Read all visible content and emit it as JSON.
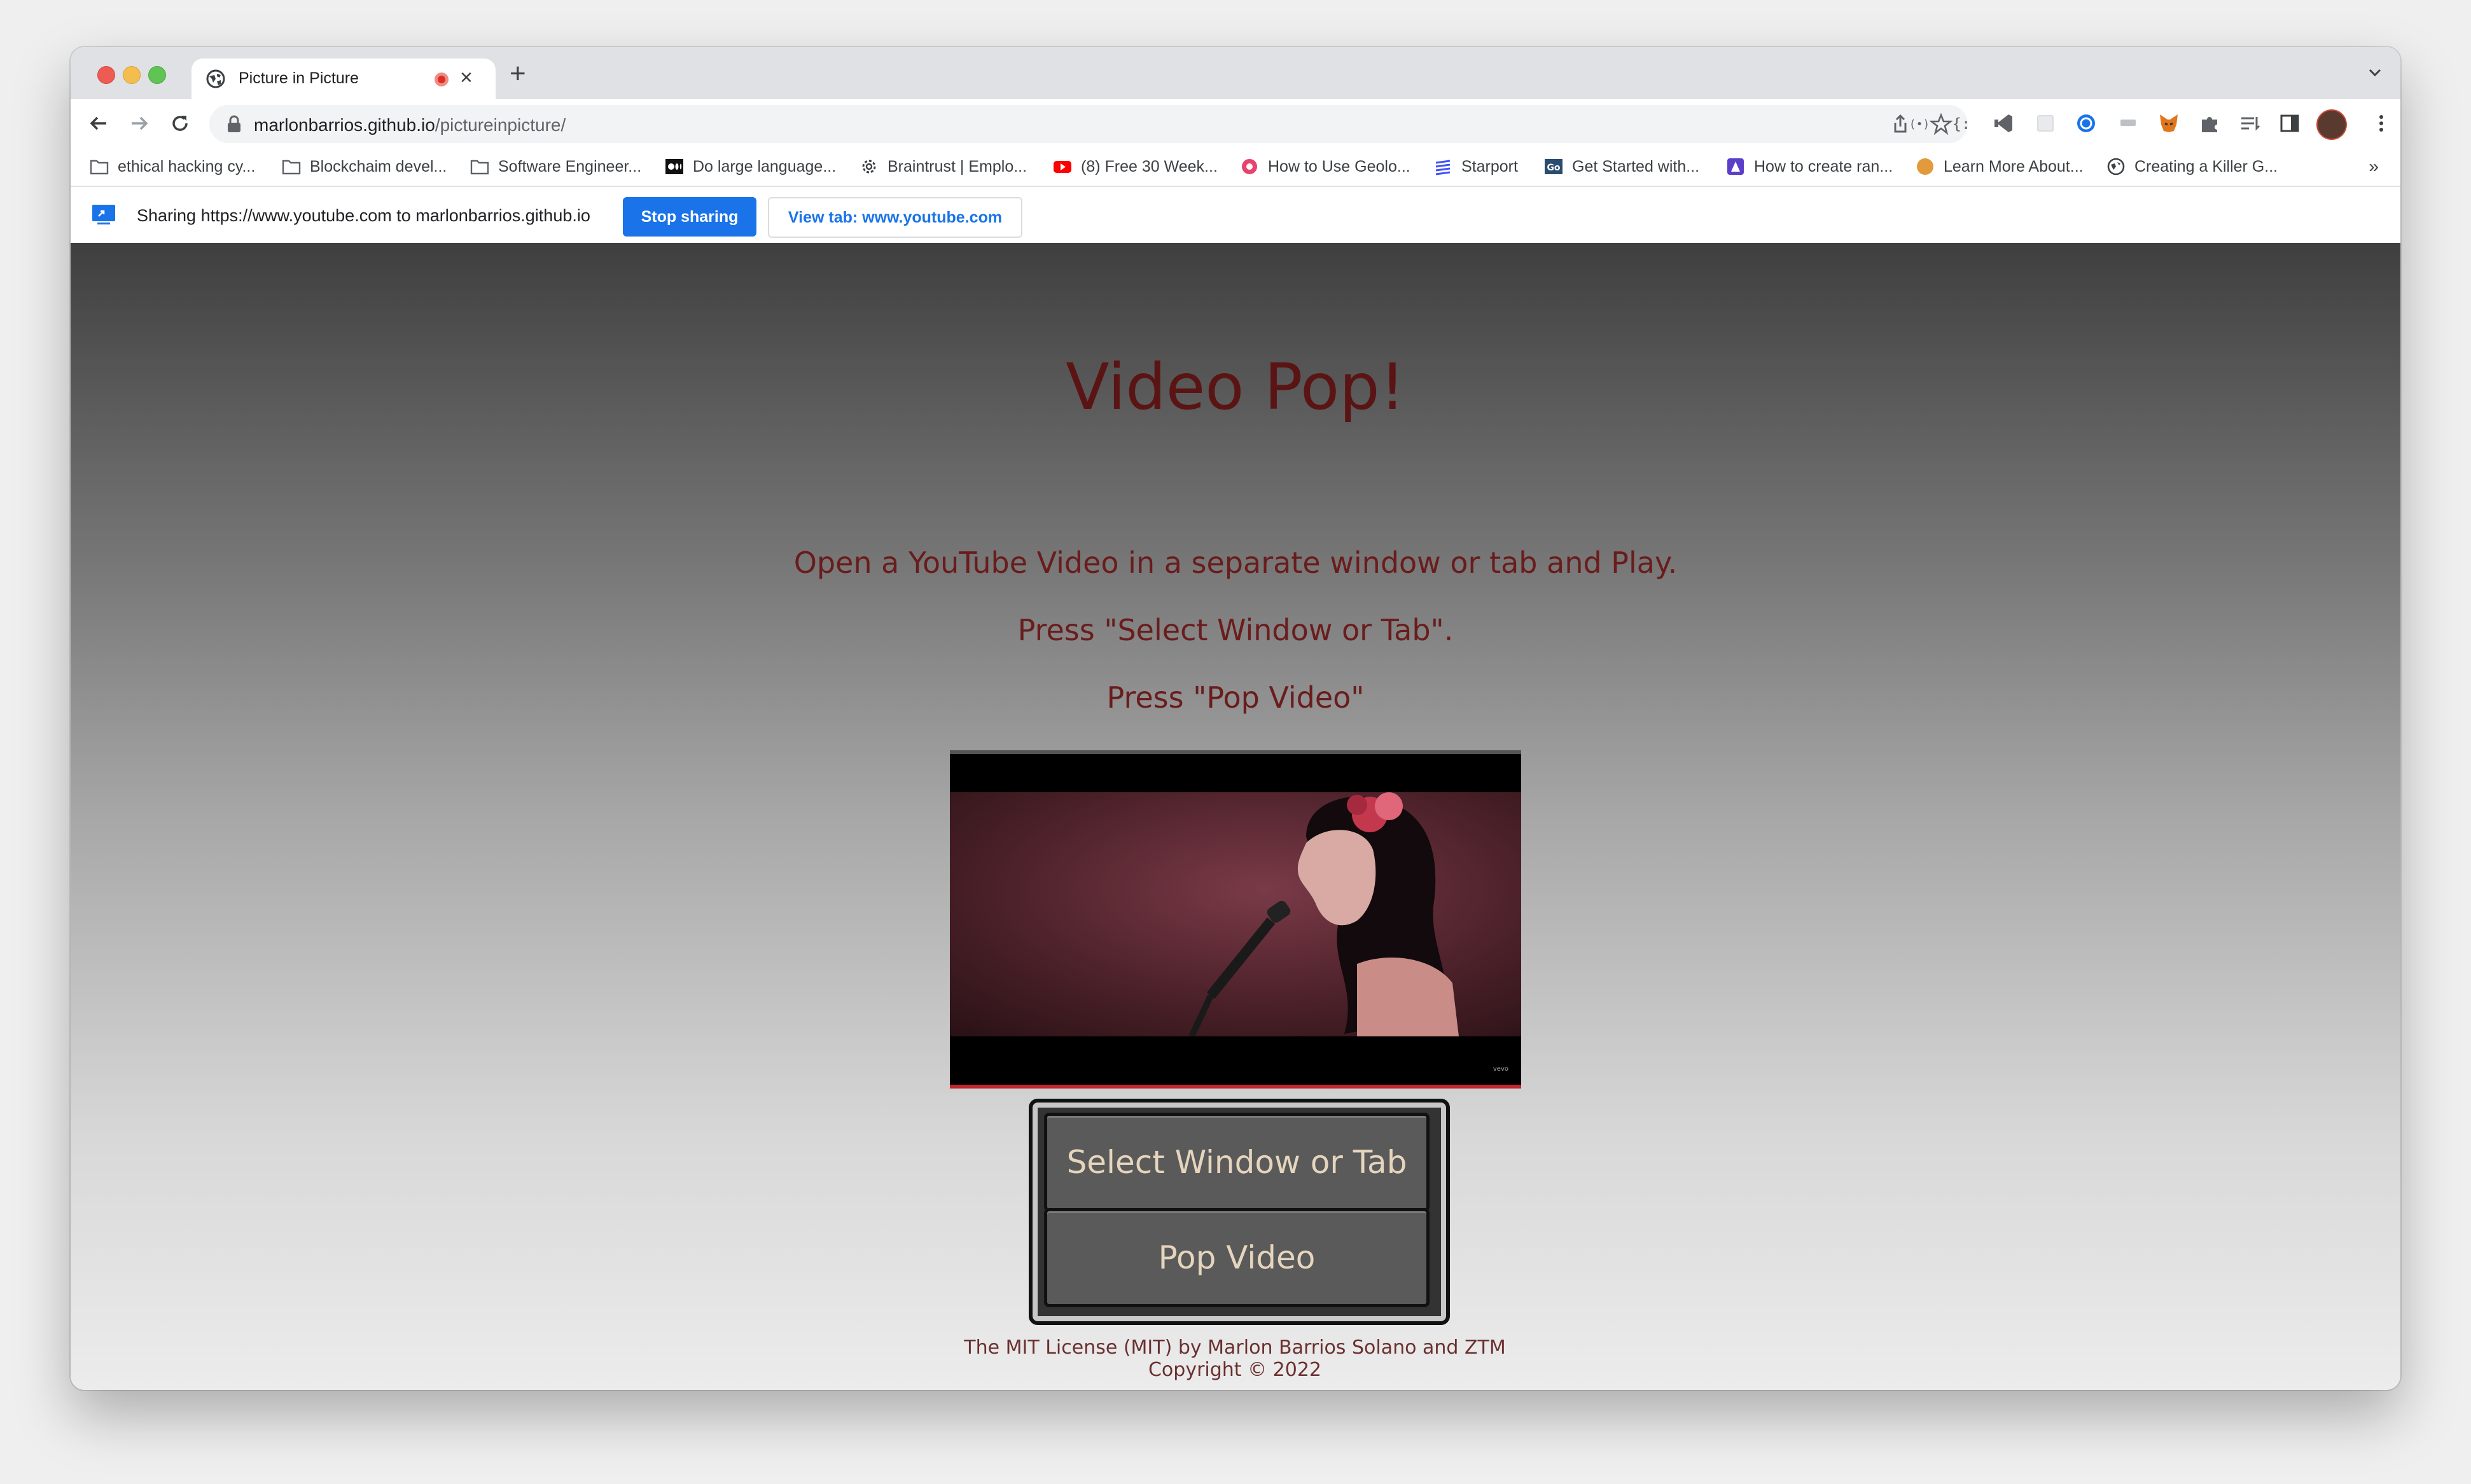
{
  "browser": {
    "tab_title": "Picture in Picture",
    "tab_close": "×",
    "new_tab": "+",
    "url_host": "marlonbarrios.github.io",
    "url_path": "/pictureinpicture/"
  },
  "bookmarks": [
    {
      "label": "ethical hacking cy...",
      "icon": "folder-icon"
    },
    {
      "label": "Blockchaim devel...",
      "icon": "folder-icon"
    },
    {
      "label": "Software Engineer...",
      "icon": "folder-icon"
    },
    {
      "label": "Do large language...",
      "icon": "medium-icon"
    },
    {
      "label": "Braintrust | Emplo...",
      "icon": "gear-icon"
    },
    {
      "label": "(8) Free 30 Week...",
      "icon": "youtube-icon"
    },
    {
      "label": "How to Use Geolo...",
      "icon": "site-icon"
    },
    {
      "label": "Starport",
      "icon": "starport-icon"
    },
    {
      "label": "Get Started with...",
      "icon": "go-icon"
    },
    {
      "label": "How to create ran...",
      "icon": "site-icon"
    },
    {
      "label": "Learn More About...",
      "icon": "orange-dot-icon"
    },
    {
      "label": "Creating a Killer G...",
      "icon": "globe-icon"
    }
  ],
  "bookmarks_more": "»",
  "sharing": {
    "message": "Sharing https://www.youtube.com to marlonbarrios.github.io",
    "stop_label": "Stop sharing",
    "view_label": "View tab: www.youtube.com"
  },
  "page": {
    "title": "Video Pop!",
    "instructions": [
      "Open a YouTube Video in a separate window or tab and Play.",
      "Press \"Select Window or Tab\".",
      "Press \"Pop Video\""
    ],
    "select_button": "Select Window or Tab",
    "pop_button": "Pop Video",
    "footer": "The MIT License (MIT) by Marlon Barrios Solano and ZTM Copyright © 2022"
  },
  "colors": {
    "accent": "#1a73e8",
    "heading": "#5a1414",
    "button_text": "#e6d5bd"
  }
}
